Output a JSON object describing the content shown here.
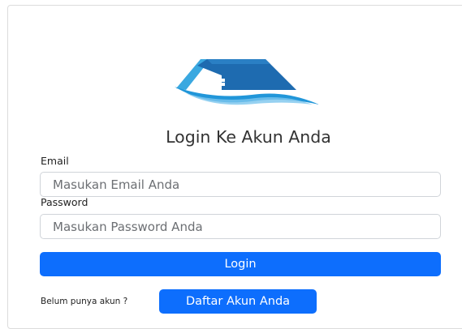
{
  "logo": {
    "icon": "house-wave-logo-icon",
    "colors": {
      "roof_dark": "#1e6bb0",
      "roof_light": "#3aa8e0",
      "wave": "#2196d9"
    }
  },
  "title": "Login Ke Akun Anda",
  "form": {
    "email_label": "Email",
    "email_placeholder": "Masukan Email Anda",
    "password_label": "Password",
    "password_placeholder": "Masukan Password Anda",
    "login_label": "Login"
  },
  "signup": {
    "prompt": "Belum punya akun ?",
    "button_label": "Daftar Akun Anda"
  },
  "colors": {
    "primary": "#0d6efd",
    "border": "#d0d4d9"
  }
}
